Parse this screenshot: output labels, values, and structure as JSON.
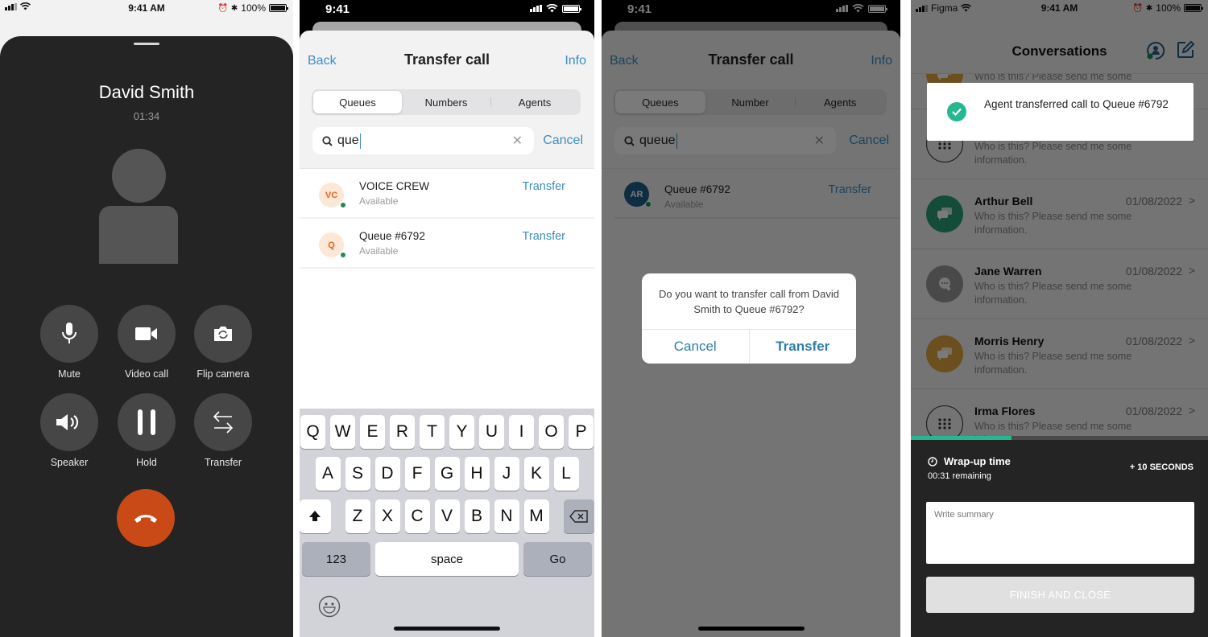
{
  "screen1": {
    "status": {
      "time": "9:41 AM",
      "battery": "100%"
    },
    "caller_name": "David Smith",
    "call_timer": "01:34",
    "controls": [
      {
        "label": "Mute",
        "icon": "microphone-icon"
      },
      {
        "label": "Video call",
        "icon": "video-camera-icon"
      },
      {
        "label": "Flip camera",
        "icon": "flip-camera-icon"
      },
      {
        "label": "Speaker",
        "icon": "speaker-icon"
      },
      {
        "label": "Hold",
        "icon": "pause-icon"
      },
      {
        "label": "Transfer",
        "icon": "transfer-arrows-icon"
      }
    ],
    "end_call_icon": "hang-up-icon",
    "colors": {
      "end_call": "#c94a17",
      "background": "#242424"
    }
  },
  "screen2": {
    "status": {
      "time": "9:41"
    },
    "nav": {
      "back": "Back",
      "title": "Transfer call",
      "info": "Info"
    },
    "tabs": [
      {
        "label": "Queues",
        "active": true
      },
      {
        "label": "Numbers",
        "active": false
      },
      {
        "label": "Agents",
        "active": false
      }
    ],
    "search": {
      "value": "que",
      "cancel": "Cancel"
    },
    "results": [
      {
        "initials": "VC",
        "name": "VOICE CREW",
        "status": "Available",
        "action": "Transfer"
      },
      {
        "initials": "Q",
        "name": "Queue #6792",
        "status": "Available",
        "action": "Transfer"
      }
    ],
    "keyboard": {
      "row1": [
        "Q",
        "W",
        "E",
        "R",
        "T",
        "Y",
        "U",
        "I",
        "O",
        "P"
      ],
      "row2": [
        "A",
        "S",
        "D",
        "F",
        "G",
        "H",
        "J",
        "K",
        "L"
      ],
      "row3": [
        "Z",
        "X",
        "C",
        "V",
        "B",
        "N",
        "M"
      ],
      "numbers": "123",
      "space": "space",
      "go": "Go"
    }
  },
  "screen3": {
    "status": {
      "time": "9:41"
    },
    "nav": {
      "back": "Back",
      "title": "Transfer call",
      "info": "Info"
    },
    "tabs": [
      {
        "label": "Queues",
        "active": true
      },
      {
        "label": "Number",
        "active": false
      },
      {
        "label": "Agents",
        "active": false
      }
    ],
    "search": {
      "value": "queue",
      "cancel": "Cancel"
    },
    "results": [
      {
        "initials": "AR",
        "name": "Queue #6792",
        "status": "Available",
        "action": "Transfer"
      }
    ],
    "dialog": {
      "message": "Do you want to transfer call from David Smith to Queue #6792?",
      "cancel": "Cancel",
      "confirm": "Transfer"
    }
  },
  "screen4": {
    "status": {
      "carrier": "Figma",
      "time": "9:41 AM",
      "battery": "100%"
    },
    "header": {
      "title": "Conversations"
    },
    "toast": {
      "message": "Agent transferred call to Queue #6792"
    },
    "conversations": [
      {
        "name": "",
        "date": "",
        "preview": "Who is this? Please send me some information.",
        "avatar": "chat-bubbles-icon",
        "color": "#e0a640"
      },
      {
        "name": "",
        "date": "",
        "preview": "Who is this? Please send me some information.",
        "avatar": "dialpad-icon",
        "color": "outline"
      },
      {
        "name": "Arthur Bell",
        "date": "01/08/2022",
        "preview": "Who is this? Please send me some information.",
        "avatar": "chat-bubbles-icon",
        "color": "#2a9d78"
      },
      {
        "name": "Jane Warren",
        "date": "01/08/2022",
        "preview": "Who is this? Please send me some information.",
        "avatar": "chat-typing-icon",
        "color": "#9a9a9a"
      },
      {
        "name": "Morris Henry",
        "date": "01/08/2022",
        "preview": "Who is this? Please send me some information.",
        "avatar": "chat-bubbles-icon",
        "color": "#e0a640"
      },
      {
        "name": "Irma Flores",
        "date": "01/08/2022",
        "preview": "Who is this? Please send me some information.",
        "avatar": "dialpad-icon",
        "color": "outline"
      }
    ],
    "wrapup": {
      "title": "Wrap-up time",
      "remaining": "00:31 remaining",
      "progress": 0.34,
      "add_time": "+ 10 SECONDS",
      "summary_placeholder": "Write summary",
      "finish": "FINISH AND CLOSE"
    },
    "colors": {
      "accent": "#25b890"
    }
  }
}
